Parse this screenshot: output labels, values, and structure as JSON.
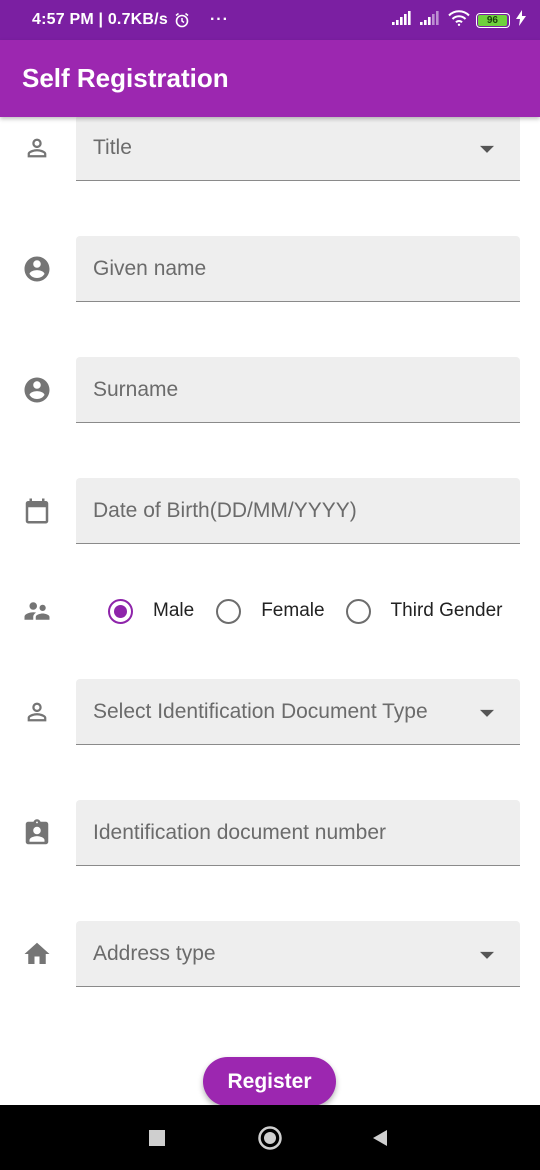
{
  "status_bar": {
    "time_speed": "4:57 PM | 0.7KB/s",
    "dots": "···",
    "battery": "96"
  },
  "app_bar": {
    "title": "Self Registration"
  },
  "form": {
    "title_select": {
      "placeholder": "Title",
      "icon": "person-outline-icon"
    },
    "given_name": {
      "placeholder": "Given name",
      "icon": "account-circle-icon"
    },
    "surname": {
      "placeholder": "Surname",
      "icon": "account-circle-icon"
    },
    "date_of_birth": {
      "placeholder": "Date of Birth(DD/MM/YYYY)",
      "icon": "calendar-icon"
    },
    "gender": {
      "icon": "people-icon",
      "options": [
        {
          "label": "Male",
          "selected": true
        },
        {
          "label": "Female",
          "selected": false
        },
        {
          "label": "Third Gender",
          "selected": false
        }
      ]
    },
    "id_doc_type": {
      "placeholder": "Select Identification Document Type",
      "icon": "person-outline-icon"
    },
    "id_doc_number": {
      "placeholder": "Identification document number",
      "icon": "badge-icon"
    },
    "address_type": {
      "placeholder": "Address type",
      "icon": "home-icon"
    }
  },
  "register_button": {
    "label": "Register"
  },
  "colors": {
    "status_bar": "#7b1fa2",
    "app_bar": "#9c27b0",
    "accent": "#8e24aa",
    "field_bg": "#eeeeee"
  }
}
